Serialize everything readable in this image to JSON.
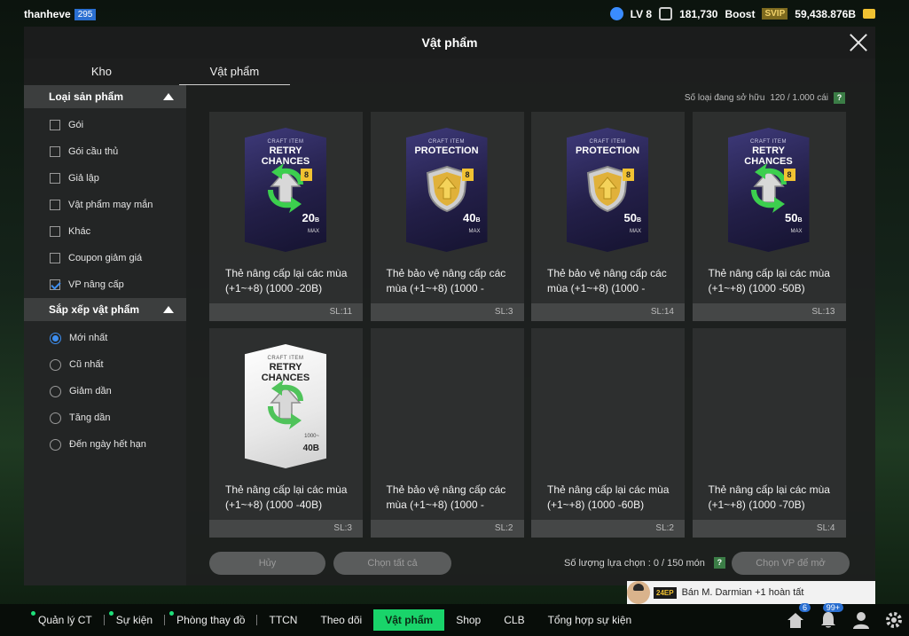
{
  "topbar": {
    "username": "thanheve",
    "user_level": "295",
    "lv": "LV 8",
    "ovr": "181,730",
    "boost": "Boost",
    "svip": "SVIP",
    "bp": "59,438.876B"
  },
  "modal": {
    "title": "Vật phẩm",
    "tabs": [
      {
        "label": "Kho"
      },
      {
        "label": "Vật phẩm"
      }
    ],
    "owned_label": "Số loại đang sở hữu",
    "owned_value": "120 / 1.000 cái",
    "help": "?"
  },
  "sidebar": {
    "category_title": "Loại sản phẩm",
    "categories": [
      {
        "label": "Gói",
        "checked": false
      },
      {
        "label": "Gói cầu thủ",
        "checked": false
      },
      {
        "label": "Giả lập",
        "checked": false
      },
      {
        "label": "Vật phẩm may mắn",
        "checked": false
      },
      {
        "label": "Khác",
        "checked": false
      },
      {
        "label": "Coupon giảm giá",
        "checked": false
      },
      {
        "label": "VP nâng cấp",
        "checked": true
      }
    ],
    "sort_title": "Sắp xếp vật phẩm",
    "sorts": [
      {
        "label": "Mới nhất",
        "selected": true
      },
      {
        "label": "Cũ nhất",
        "selected": false
      },
      {
        "label": "Giảm dần",
        "selected": false
      },
      {
        "label": "Tăng dần",
        "selected": false
      },
      {
        "label": "Đến ngày hết hạn",
        "selected": false
      }
    ]
  },
  "items": [
    {
      "craft": "CRAFT ITEM",
      "name": "RETRY CHANCES",
      "kind": "retry",
      "style": "dark",
      "value": "20",
      "unit": "B",
      "sub": "MAX",
      "title1": "Thẻ nâng cấp lại các mùa",
      "title2": "(+1~+8) (1000 -20B)",
      "qty": "SL:11",
      "show_image": true
    },
    {
      "craft": "CRAFT ITEM",
      "name": "PROTECTION",
      "kind": "protect",
      "style": "dark",
      "value": "40",
      "unit": "B",
      "sub": "MAX",
      "title1": "Thẻ bảo vệ nâng cấp các",
      "title2": "mùa (+1~+8) (1000 -",
      "qty": "SL:3",
      "show_image": true
    },
    {
      "craft": "CRAFT ITEM",
      "name": "PROTECTION",
      "kind": "protect",
      "style": "dark",
      "value": "50",
      "unit": "B",
      "sub": "MAX",
      "title1": "Thẻ bảo vệ nâng cấp các",
      "title2": "mùa (+1~+8) (1000 -",
      "qty": "SL:14",
      "show_image": true
    },
    {
      "craft": "CRAFT ITEM",
      "name": "RETRY CHANCES",
      "kind": "retry",
      "style": "dark",
      "value": "50",
      "unit": "B",
      "sub": "MAX",
      "title1": "Thẻ nâng cấp lại các mùa",
      "title2": "(+1~+8) (1000 -50B)",
      "qty": "SL:13",
      "show_image": true
    },
    {
      "craft": "CRAFT ITEM",
      "name": "RETRY CHANCES",
      "kind": "retry",
      "style": "light",
      "value": "40B",
      "unit": "",
      "sub": "1000~",
      "title1": "Thẻ nâng cấp lại các mùa",
      "title2": "(+1~+8) (1000 -40B)",
      "qty": "SL:3",
      "show_image": true
    },
    {
      "craft": "",
      "name": "",
      "kind": "none",
      "style": "dark",
      "value": "",
      "unit": "",
      "sub": "",
      "title1": "Thẻ bảo vệ nâng cấp các",
      "title2": "mùa (+1~+8) (1000 -",
      "qty": "SL:2",
      "show_image": false
    },
    {
      "craft": "",
      "name": "",
      "kind": "none",
      "style": "dark",
      "value": "",
      "unit": "",
      "sub": "",
      "title1": "Thẻ nâng cấp lại các mùa",
      "title2": "(+1~+8) (1000 -60B)",
      "qty": "SL:2",
      "show_image": false
    },
    {
      "craft": "",
      "name": "",
      "kind": "none",
      "style": "dark",
      "value": "",
      "unit": "",
      "sub": "",
      "title1": "Thẻ nâng cấp lại các mùa",
      "title2": "(+1~+8) (1000 -70B)",
      "qty": "SL:4",
      "show_image": false
    }
  ],
  "footer": {
    "cancel": "Hủy",
    "select_all": "Chọn tất cả",
    "selection_count": "Số lượng lựa chọn : 0 / 150 món",
    "help": "?",
    "open": "Chọn VP để mở"
  },
  "notification": {
    "tag": "24EP",
    "text": "Bán M. Darmian +1 hoàn tất"
  },
  "bottom_nav": [
    {
      "label": "Quản lý CT",
      "dot": true,
      "active": false
    },
    {
      "label": "Sự kiện",
      "dot": true,
      "active": false
    },
    {
      "label": "Phòng thay đồ",
      "dot": true,
      "active": false
    },
    {
      "label": "TTCN",
      "dot": false,
      "active": false
    },
    {
      "label": "Theo dõi",
      "dot": false,
      "active": false
    },
    {
      "label": "Vật phẩm",
      "dot": false,
      "active": true
    },
    {
      "label": "Shop",
      "dot": false,
      "active": false
    },
    {
      "label": "CLB",
      "dot": false,
      "active": false
    },
    {
      "label": "Tổng hợp sự kiện",
      "dot": false,
      "active": false
    }
  ],
  "bottom_icons": {
    "home_badge": "6",
    "bell_badge": "99+"
  },
  "colors": {
    "accent_green": "#19d46a",
    "checkbox_blue": "#3d8ef0",
    "card_dark": "#231f48",
    "gold": "#f1c232"
  }
}
